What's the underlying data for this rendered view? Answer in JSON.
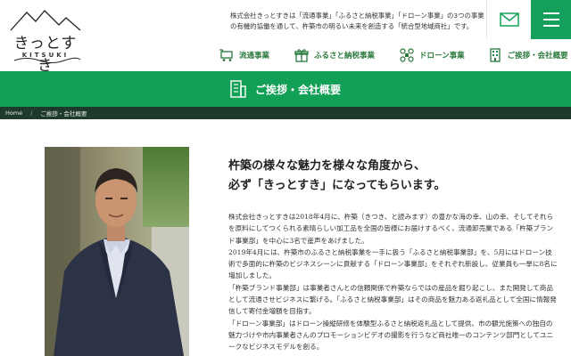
{
  "logo": {
    "jp": "きっとすき",
    "en": "KITSUKI"
  },
  "header": {
    "intro": "株式会社きっとすきは「流通事業」「ふるさと納税事業」「ドローン事業」の3つの事業の有機的協働を通して、杵築市の明るい未来を創造する「統合型地域商社」です。",
    "mail_icon": "mail-icon",
    "menu_icon": "hamburger-icon"
  },
  "nav": [
    {
      "label": "流通事業",
      "icon": "cart-icon"
    },
    {
      "label": "ふるさと納税事業",
      "icon": "gift-icon"
    },
    {
      "label": "ドローン事業",
      "icon": "drone-icon"
    },
    {
      "label": "ご挨拶・会社概要",
      "icon": "building-icon"
    }
  ],
  "banner": {
    "title": "ご挨拶・会社概要",
    "icon": "building-icon"
  },
  "breadcrumb": {
    "home": "Home",
    "separator": "/",
    "current": "ご挨拶・会社概要"
  },
  "content": {
    "heading_line1": "杵築の様々な魅力を様々な角度から、",
    "heading_line2": "必ず「きっとすき」になってもらいます。",
    "paragraphs": [
      "株式会社きっとすきは2018年4月に、杵築（きつき、と読みます）の豊かな海の幸、山の幸、そしてそれらを原料にしてつくられる素晴らしい加工品を全国の皆様にお届けするべく、流通卸売業である「杵築ブランド事業部」を中心に3名で産声をあげました。",
      "2019年4月には、杵築市のふるさと納税事業を一手に扱う「ふるさと納税事業部」を、5月にはドローン技術で多面的に杵築のビジネスシーンに貢献する「ドローン事業部」をそれぞれ新設し、従業員も一挙に8名に増加しました。",
      "「杵築ブランド事業部」は事業者さんとの信頼関係で杵築ならではの産品を掘り起こし、また開発して商品として流通させビジネスに繋げる。「ふるさと納税事業部」はその商品を魅力ある返礼品として全国に情報発信して寄付金増額を目指す。",
      "「ドローン事業部」はドローン操縦研修を体験型ふるさと納税返礼品として提供、市の観光施策への独自の魅力づけや市内事業者さんのプロモーションビデオの撮影を行うなど商社唯一のコンテンツ部門としてユニークなビジネスモデルを創る。"
    ]
  },
  "colors": {
    "brand_green": "#12a057",
    "nav_green": "#2a7a3e",
    "breadcrumb_bg": "#1d3a2a"
  }
}
